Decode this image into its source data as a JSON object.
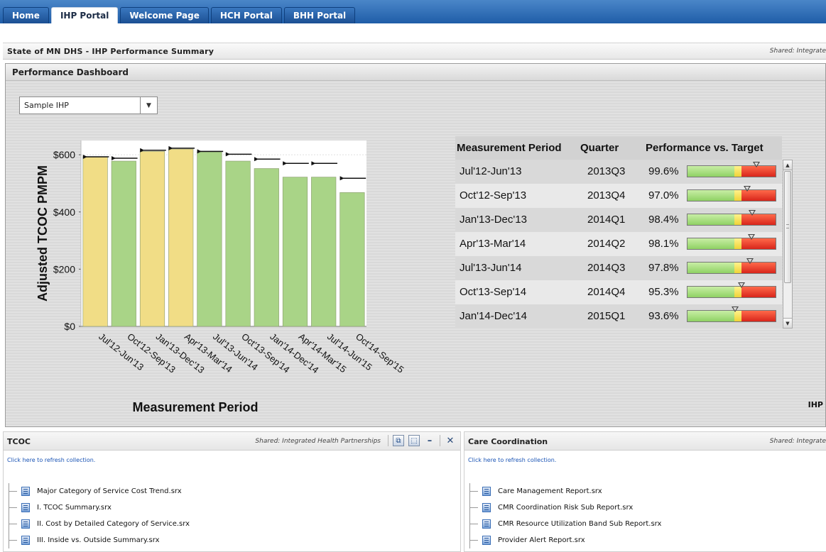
{
  "tabs": [
    {
      "label": "Home",
      "active": false
    },
    {
      "label": "IHP Portal",
      "active": true
    },
    {
      "label": "Welcome Page",
      "active": false
    },
    {
      "label": "HCH Portal",
      "active": false
    },
    {
      "label": "BHH Portal",
      "active": false
    }
  ],
  "summary": {
    "title": "State of MN DHS - IHP Performance Summary",
    "shared": "Shared: Integrate"
  },
  "dashboard": {
    "title": "Performance Dashboard",
    "selector_value": "Sample IHP",
    "right_label": "IHP"
  },
  "chart_data": {
    "type": "bar",
    "xlabel": "Measurement Period",
    "ylabel": "Adjusted TCOC PMPM",
    "ylim": [
      0,
      650
    ],
    "yticks": [
      "$0",
      "$200",
      "$400",
      "$600"
    ],
    "ytick_values": [
      0,
      200,
      400,
      600
    ],
    "categories": [
      "Jul'12-Jun'13",
      "Oct'12-Sep'13",
      "Jan'13-Dec'13",
      "Apr'13-Mar'14",
      "Jul'13-Jun'14",
      "Oct'13-Sep'14",
      "Jan'14-Dec'14",
      "Apr'14-Mar'15",
      "Jul'14-Jun'15",
      "Oct'14-Sep'15"
    ],
    "values": [
      592,
      578,
      612,
      620,
      610,
      578,
      552,
      522,
      522,
      468
    ],
    "targets": [
      593,
      588,
      616,
      623,
      612,
      602,
      585,
      570,
      570,
      518
    ],
    "bar_colors": [
      "#f1dd86",
      "#a9d487",
      "#f1dd86",
      "#f1dd86",
      "#a9d487",
      "#a9d487",
      "#a9d487",
      "#a9d487",
      "#a9d487",
      "#a9d487"
    ],
    "grid": false,
    "legend": "none"
  },
  "table": {
    "headers": [
      "Measurement Period",
      "Quarter",
      "Performance vs. Target"
    ],
    "rows": [
      {
        "period": "Jul'12-Jun'13",
        "quarter": "2013Q3",
        "performance": "99.6%",
        "level": 0.996
      },
      {
        "period": "Oct'12-Sep'13",
        "quarter": "2013Q4",
        "performance": "97.0%",
        "level": 0.97
      },
      {
        "period": "Jan'13-Dec'13",
        "quarter": "2014Q1",
        "performance": "98.4%",
        "level": 0.984
      },
      {
        "period": "Apr'13-Mar'14",
        "quarter": "2014Q2",
        "performance": "98.1%",
        "level": 0.981
      },
      {
        "period": "Jul'13-Jun'14",
        "quarter": "2014Q3",
        "performance": "97.8%",
        "level": 0.978
      },
      {
        "period": "Oct'13-Sep'14",
        "quarter": "2014Q4",
        "performance": "95.3%",
        "level": 0.953
      },
      {
        "period": "Jan'14-Dec'14",
        "quarter": "2015Q1",
        "performance": "93.6%",
        "level": 0.936
      }
    ]
  },
  "tcoc": {
    "title": "TCOC",
    "shared": "Shared: Integrated Health Partnerships",
    "refresh": "Click here to refresh collection.",
    "items": [
      "Major Category of Service Cost Trend.srx",
      "I. TCOC Summary.srx",
      "II. Cost by Detailed Category of Service.srx",
      "III. Inside vs. Outside Summary.srx"
    ]
  },
  "care": {
    "title": "Care Coordination",
    "shared": "Shared: Integrate",
    "refresh": "Click here to refresh collection.",
    "items": [
      "Care Management Report.srx",
      "CMR Coordination Risk Sub Report.srx",
      "CMR Resource Utilization Band Sub Report.srx",
      "Provider Alert Report.srx"
    ]
  },
  "colors": {
    "accent": "#1f5da8",
    "bar_yellow": "#f1dd86",
    "bar_green": "#a9d487",
    "gauge_red": "#d8261b"
  }
}
